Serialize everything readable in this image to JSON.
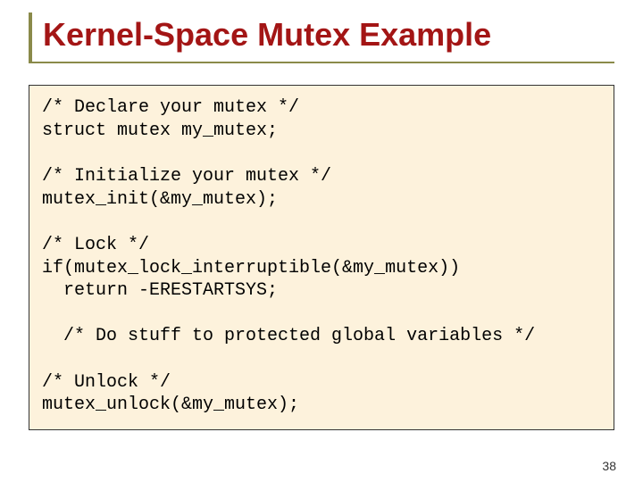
{
  "title": "Kernel-Space Mutex Example",
  "code": "/* Declare your mutex */\nstruct mutex my_mutex;\n\n/* Initialize your mutex */\nmutex_init(&my_mutex);\n\n/* Lock */\nif(mutex_lock_interruptible(&my_mutex))\n  return -ERESTARTSYS;\n\n  /* Do stuff to protected global variables */\n\n/* Unlock */\nmutex_unlock(&my_mutex);",
  "page_number": "38"
}
